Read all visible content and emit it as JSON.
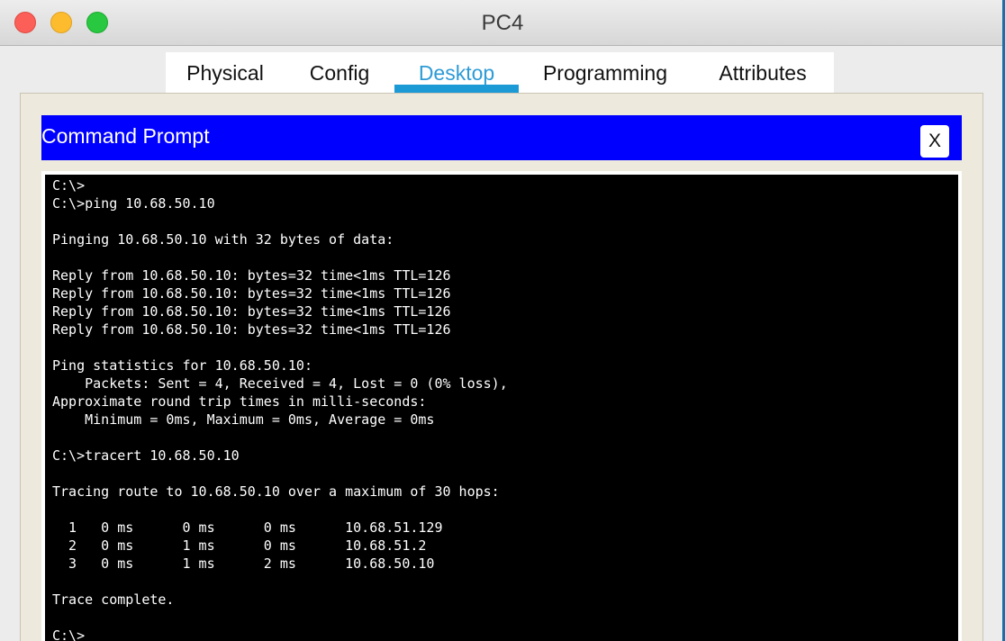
{
  "window": {
    "title": "PC4"
  },
  "tabs": [
    {
      "label": "Physical",
      "active": false
    },
    {
      "label": "Config",
      "active": false
    },
    {
      "label": "Desktop",
      "active": true
    },
    {
      "label": "Programming",
      "active": false
    },
    {
      "label": "Attributes",
      "active": false
    }
  ],
  "command_prompt": {
    "title": "Command Prompt",
    "close_label": "X",
    "lines": [
      "",
      "C:\\>",
      "C:\\>ping 10.68.50.10",
      "",
      "Pinging 10.68.50.10 with 32 bytes of data:",
      "",
      "Reply from 10.68.50.10: bytes=32 time<1ms TTL=126",
      "Reply from 10.68.50.10: bytes=32 time<1ms TTL=126",
      "Reply from 10.68.50.10: bytes=32 time<1ms TTL=126",
      "Reply from 10.68.50.10: bytes=32 time<1ms TTL=126",
      "",
      "Ping statistics for 10.68.50.10:",
      "    Packets: Sent = 4, Received = 4, Lost = 0 (0% loss),",
      "Approximate round trip times in milli-seconds:",
      "    Minimum = 0ms, Maximum = 0ms, Average = 0ms",
      "",
      "C:\\>tracert 10.68.50.10",
      "",
      "Tracing route to 10.68.50.10 over a maximum of 30 hops:",
      "",
      "  1   0 ms      0 ms      0 ms      10.68.51.129",
      "  2   0 ms      1 ms      0 ms      10.68.51.2",
      "  3   0 ms      1 ms      2 ms      10.68.50.10",
      "",
      "Trace complete.",
      "",
      "C:\\>"
    ]
  },
  "colors": {
    "header_blue": "#0000ff",
    "active_tab": "#2e9bd6",
    "terminal_bg": "#000000",
    "terminal_fg": "#ffffff"
  }
}
